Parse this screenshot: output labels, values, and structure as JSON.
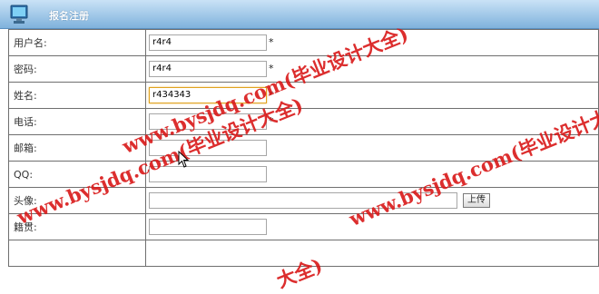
{
  "header": {
    "title": "报名注册"
  },
  "form": {
    "username": {
      "label": "用户名:",
      "value": "r4r4",
      "required": "*"
    },
    "password": {
      "label": "密码:",
      "value": "r4r4",
      "required": "*"
    },
    "name": {
      "label": "姓名:",
      "value": "r434343",
      "required": "*"
    },
    "phone": {
      "label": "电话:",
      "value": "",
      "required": "*"
    },
    "email": {
      "label": "邮箱:",
      "value": ""
    },
    "qq": {
      "label": "QQ:",
      "value": ""
    },
    "avatar": {
      "label": "头像:",
      "value": "",
      "upload_label": "上传"
    },
    "hometown": {
      "label": "籍贯:",
      "value": ""
    }
  },
  "watermark": {
    "text_top": "www.bysjdq.com(毕业设计大全)",
    "text_left": "www.bysjdq.com(毕业设计大全)",
    "text_right": "www.bysjdq.com(毕业设计大全)",
    "text_bottom": "大全)",
    "color": "#d91818"
  },
  "colors": {
    "header_top": "#c9e2f6",
    "header_bottom": "#7fb2dc",
    "focus_border": "#e0a31e"
  }
}
